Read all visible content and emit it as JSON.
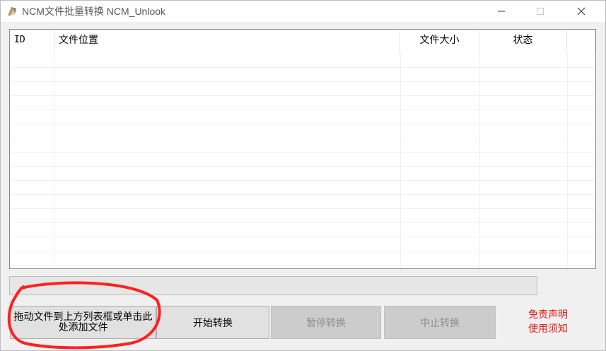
{
  "window": {
    "title": "NCM文件批量转换 NCM_Unlook",
    "controls": {
      "minimize": "minimize-icon",
      "maximize": "maximize-icon",
      "close": "close-icon"
    }
  },
  "list": {
    "columns": [
      "ID",
      "文件位置",
      "文件大小",
      "状态",
      ""
    ],
    "rows": []
  },
  "progress": {
    "value": 0
  },
  "buttons": {
    "add_files": "拖动文件到上方列表框或单击此处添加文件",
    "start": "开始转换",
    "pause": "暂停转换",
    "stop": "中止转换"
  },
  "links": {
    "disclaimer": "免责声明",
    "usage": "使用须知"
  },
  "colors": {
    "disclaimer_text": "#e81b1b",
    "annotation": "#ff2020",
    "disabled_button": "#cccccc"
  }
}
